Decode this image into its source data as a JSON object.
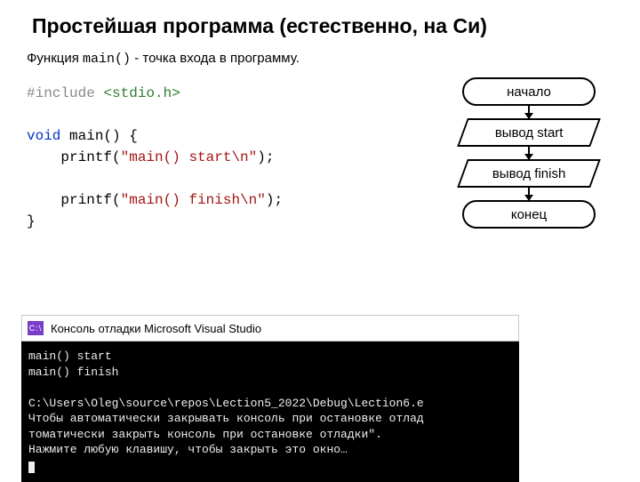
{
  "title": "Простейшая программа (естественно, на Си)",
  "subtitle_prefix": "Функция ",
  "subtitle_mono": "main()",
  "subtitle_suffix": " - точка входа в программу.",
  "code": {
    "include_kw": "#include",
    "include_hdr": "<stdio.h>",
    "void_kw": "void",
    "main_sig": " main() {",
    "p1a": "    printf(",
    "p1s": "\"main() start\\n\"",
    "p1b": ");",
    "p2a": "    printf(",
    "p2s": "\"main() finish\\n\"",
    "p2b": ");",
    "close": "}"
  },
  "flow": {
    "start": "начало",
    "io1": "вывод start",
    "io2": "вывод finish",
    "end": "конец"
  },
  "console": {
    "icon": "C:\\",
    "title": "Консоль отладки Microsoft Visual Studio",
    "l1": "main() start",
    "l2": "main() finish",
    "l3": "",
    "l4": "C:\\Users\\Oleg\\source\\repos\\Lection5_2022\\Debug\\Lection6.e",
    "l5": "Чтобы автоматически закрывать консоль при остановке отлад",
    "l6": "томатически закрыть консоль при остановке отладки\".",
    "l7": "Нажмите любую клавишу, чтобы закрыть это окно…"
  }
}
